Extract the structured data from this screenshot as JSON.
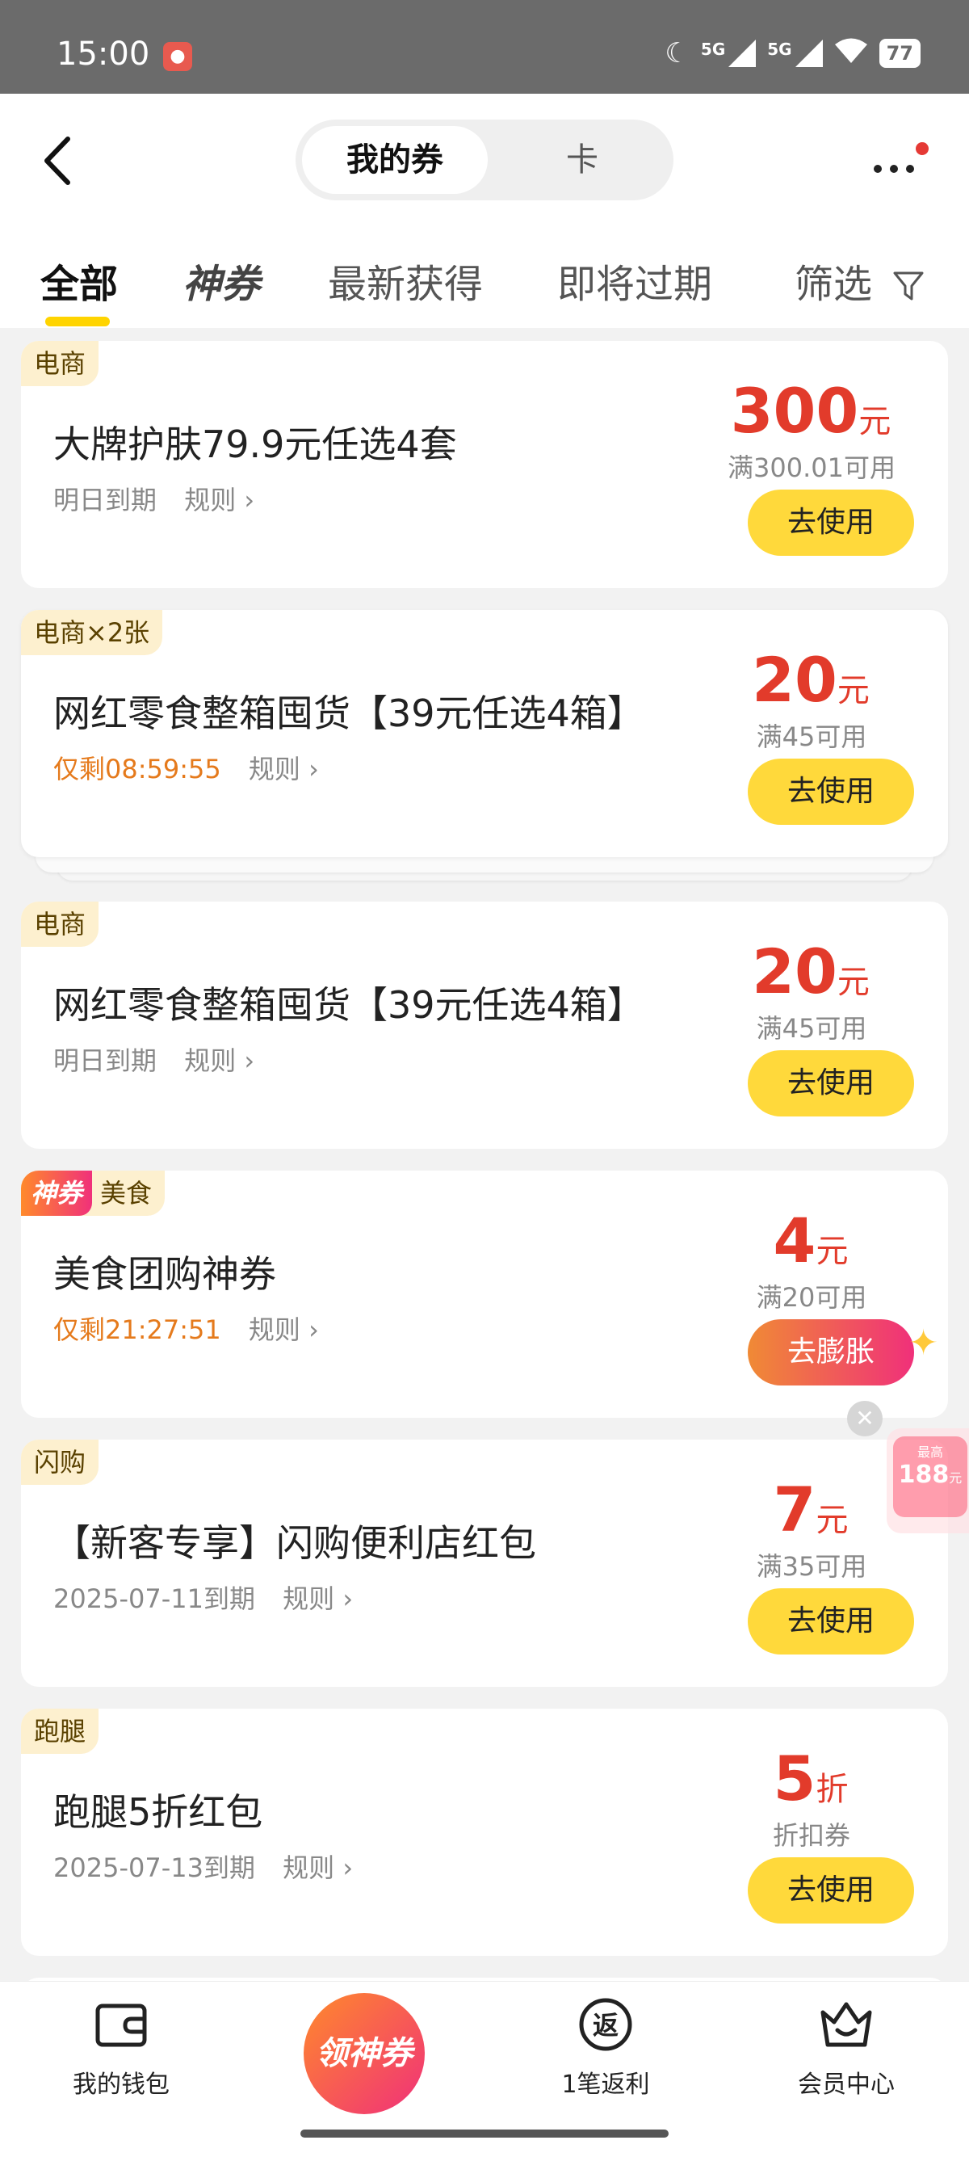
{
  "status": {
    "time": "15:00",
    "sig1": "5G",
    "sig2": "5G",
    "battery": "77"
  },
  "header": {
    "segments": [
      "我的券",
      "卡"
    ],
    "tabs": [
      "全部",
      "神券",
      "最新获得",
      "即将过期",
      "筛选"
    ]
  },
  "coupons": [
    {
      "tag": "电商",
      "title": "大牌护肤79.9元任选4套",
      "expiry": "明日到期",
      "rule": "规则",
      "amount": "300",
      "unit": "元",
      "condition": "满300.01可用",
      "button": "去使用"
    },
    {
      "tag": "电商×2张",
      "title": "网红零食整箱囤货【39元任选4箱】",
      "expiry": "仅剩08:59:55",
      "rule": "规则",
      "amount": "20",
      "unit": "元",
      "condition": "满45可用",
      "button": "去使用"
    },
    {
      "tag": "电商",
      "title": "网红零食整箱囤货【39元任选4箱】",
      "expiry": "明日到期",
      "rule": "规则",
      "amount": "20",
      "unit": "元",
      "condition": "满45可用",
      "button": "去使用"
    },
    {
      "tag_shen": "神券",
      "tag": "美食",
      "title": "美食团购神券",
      "expiry": "仅剩21:27:51",
      "rule": "规则",
      "amount": "4",
      "unit": "元",
      "condition": "满20可用",
      "button": "去膨胀"
    },
    {
      "tag": "闪购",
      "title": "【新客专享】闪购便利店红包",
      "expiry": "2025-07-11到期",
      "rule": "规则",
      "amount": "7",
      "unit": "元",
      "condition": "满35可用",
      "button": "去使用"
    },
    {
      "tag": "跑腿",
      "title": "跑腿5折红包",
      "expiry": "2025-07-13到期",
      "rule": "规则",
      "amount": "5",
      "unit": "折",
      "condition": "折扣券",
      "button": "去使用"
    }
  ],
  "promo": {
    "top": "最高",
    "amount": "188",
    "unit": "元"
  },
  "bottom_nav": {
    "wallet": "我的钱包",
    "center": "领神券",
    "rebate": "1笔返利",
    "rebate_icon": "返",
    "member": "会员中心"
  }
}
